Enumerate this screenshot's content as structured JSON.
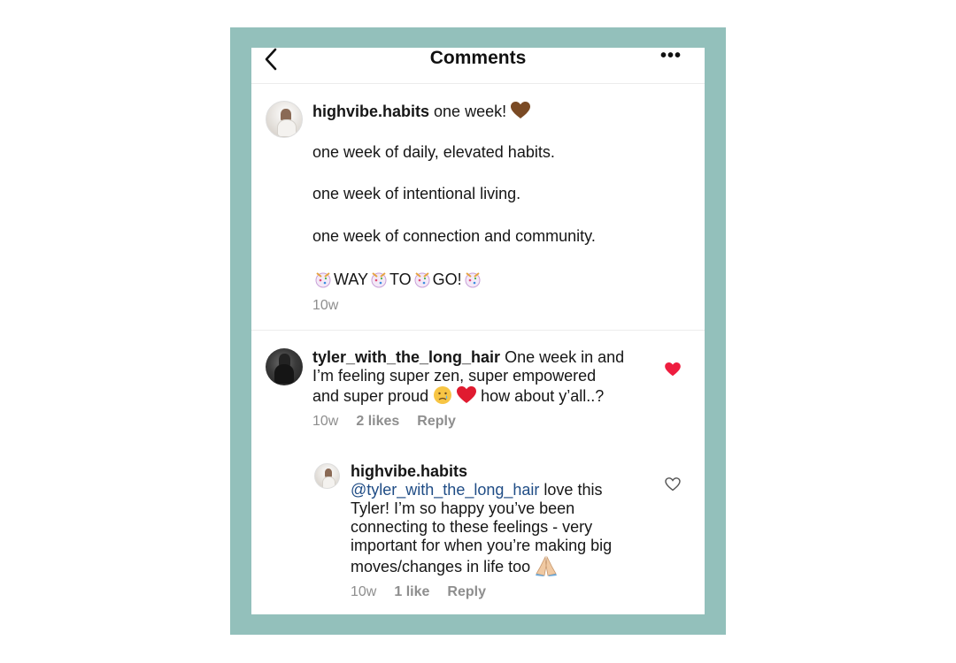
{
  "header": {
    "title": "Comments",
    "more_label": "•••"
  },
  "post": {
    "username": "highvibe.habits",
    "first_line": "one week!",
    "lines": [
      "one week of daily, elevated habits.",
      "one week of intentional living.",
      "one week of connection and community."
    ],
    "celebration_words": [
      "WAY",
      "TO",
      "GO!"
    ],
    "time": "10w",
    "emoji_heart_color": "#7a4a24"
  },
  "comment": {
    "username": "tyler_with_the_long_hair",
    "line1": "One week in and",
    "line2": "I’m feeling super zen, super empowered",
    "line3_a": "and super proud",
    "line3_b": "how about y’all..?",
    "time": "10w",
    "likes": "2 likes",
    "reply": "Reply",
    "liked": true,
    "heart_color": "#ee1d3f"
  },
  "reply": {
    "username": "highvibe.habits",
    "mention": "@tyler_with_the_long_hair",
    "line1_rest": "love this",
    "line2": "Tyler! I’m so happy you’ve been",
    "line3": "connecting to these feelings - very",
    "line4": "important for when you’re making big",
    "line5": "moves/changes in life too",
    "time": "10w",
    "likes": "1 like",
    "reply": "Reply",
    "liked": false
  },
  "colors": {
    "frame": "#93c0bb",
    "meta_text": "#8e8e8e",
    "mention": "#1f4c85"
  }
}
